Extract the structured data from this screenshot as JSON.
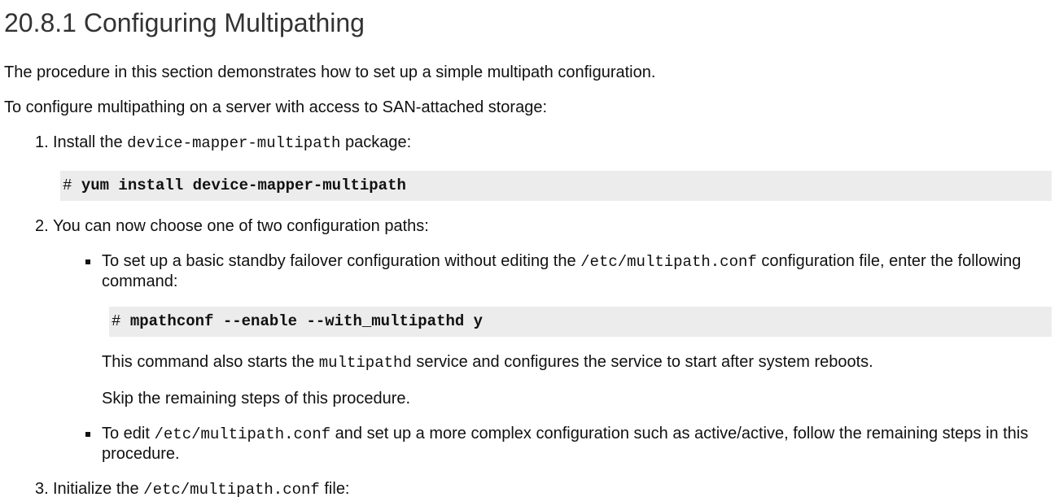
{
  "heading": "20.8.1 Configuring Multipathing",
  "intro": "The procedure in this section demonstrates how to set up a simple multipath configuration.",
  "lead": "To configure multipathing on a server with access to SAN-attached storage:",
  "steps": [
    {
      "number": "1.",
      "text_before": "Install the ",
      "code": "device-mapper-multipath",
      "text_after": " package:",
      "command": {
        "prompt": "#",
        "text": "yum install device-mapper-multipath"
      }
    },
    {
      "number": "2.",
      "text": "You can now choose one of two configuration paths:",
      "options": [
        {
          "text_before": "To set up a basic standby failover configuration without editing the ",
          "code": "/etc/multipath.conf",
          "text_after": " configuration file, enter the following command:",
          "command": {
            "prompt": "#",
            "text": "mpathconf --enable --with_multipathd y"
          },
          "note_before": "This command also starts the ",
          "note_code": "multipathd",
          "note_after": " service and configures the service to start after system reboots.",
          "skip": "Skip the remaining steps of this procedure."
        },
        {
          "text_before": "To edit ",
          "code": "/etc/multipath.conf",
          "text_after": " and set up a more complex configuration such as active/active, follow the remaining steps in this procedure."
        }
      ]
    },
    {
      "number": "3.",
      "text_before": "Initialize the ",
      "code": "/etc/multipath.conf",
      "text_after": " file:"
    }
  ]
}
